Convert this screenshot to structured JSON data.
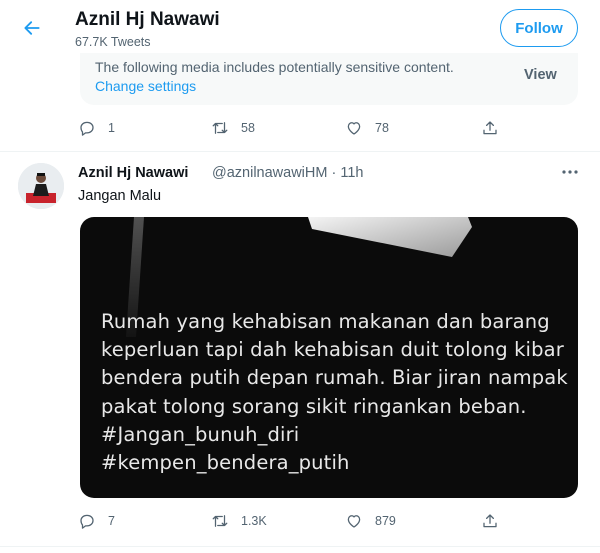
{
  "header": {
    "name": "Aznil Hj Nawawi",
    "tweet_count": "67.7K Tweets",
    "follow_label": "Follow"
  },
  "sensitive": {
    "message": "The following media includes potentially sensitive content.",
    "change_settings": "Change settings",
    "view_label": "View"
  },
  "tweet1_actions": {
    "replies": "1",
    "retweets": "58",
    "likes": "78"
  },
  "tweet2": {
    "display_name": "Aznil Hj Nawawi",
    "meta": "@aznilnawawiHM · 11h",
    "text": "Jangan Malu",
    "image_lines": [
      "Rumah yang kehabisan makanan dan barang",
      "keperluan tapi dah kehabisan duit tolong kibar",
      "bendera putih depan rumah. Biar jiran nampak",
      "pakat tolong sorang sikit ringankan beban.",
      "#Jangan_bunuh_diri",
      "#kempen_bendera_putih"
    ],
    "actions": {
      "replies": "7",
      "retweets": "1.3K",
      "likes": "879"
    }
  },
  "colors": {
    "accent": "#1d9bf0",
    "secondary_text": "#536471",
    "primary_text": "#0f1419",
    "card_bg": "#f7f9f9",
    "media_bg": "#0b0b0b"
  }
}
